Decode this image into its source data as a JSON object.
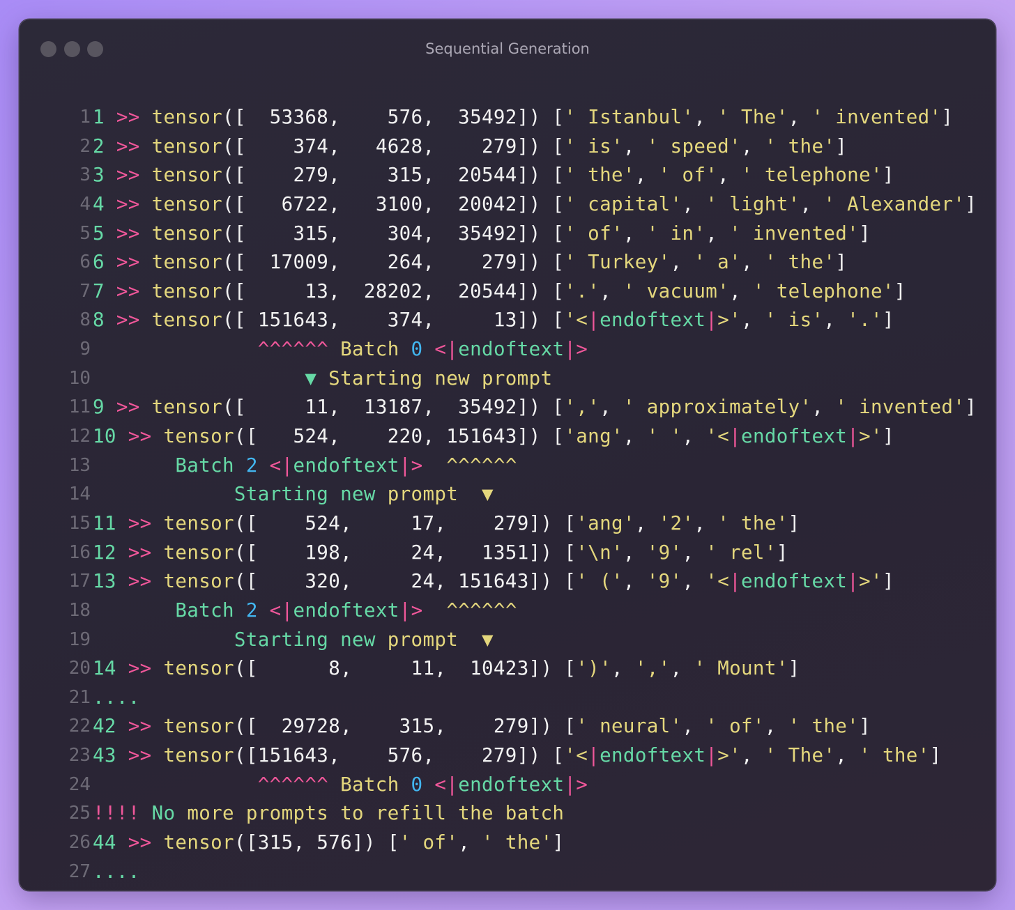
{
  "window": {
    "title": "Sequential Generation",
    "buttons": [
      "close",
      "minimize",
      "zoom"
    ]
  },
  "colors": {
    "green": "#66d9a6",
    "pink": "#f0579a",
    "yellow": "#e4d77d",
    "white": "#f2f2f2",
    "cyan": "#42b6f0",
    "line_number": "#6d6a76",
    "background": "#2a2535"
  },
  "lines": [
    {
      "n": "1",
      "segs": [
        [
          "g",
          "1"
        ],
        [
          "w",
          " "
        ],
        [
          "p",
          ">>"
        ],
        [
          "w",
          " "
        ],
        [
          "y",
          "tensor"
        ],
        [
          "w",
          "([  53368,    576,  35492]) ["
        ],
        [
          "y",
          "' Istanbul'"
        ],
        [
          "w",
          ", "
        ],
        [
          "y",
          "' The'"
        ],
        [
          "w",
          ", "
        ],
        [
          "y",
          "' invented'"
        ],
        [
          "w",
          "]"
        ]
      ]
    },
    {
      "n": "2",
      "segs": [
        [
          "g",
          "2"
        ],
        [
          "w",
          " "
        ],
        [
          "p",
          ">>"
        ],
        [
          "w",
          " "
        ],
        [
          "y",
          "tensor"
        ],
        [
          "w",
          "([    374,   4628,    279]) ["
        ],
        [
          "y",
          "' is'"
        ],
        [
          "w",
          ", "
        ],
        [
          "y",
          "' speed'"
        ],
        [
          "w",
          ", "
        ],
        [
          "y",
          "' the'"
        ],
        [
          "w",
          "]"
        ]
      ]
    },
    {
      "n": "3",
      "segs": [
        [
          "g",
          "3"
        ],
        [
          "w",
          " "
        ],
        [
          "p",
          ">>"
        ],
        [
          "w",
          " "
        ],
        [
          "y",
          "tensor"
        ],
        [
          "w",
          "([    279,    315,  20544]) ["
        ],
        [
          "y",
          "' the'"
        ],
        [
          "w",
          ", "
        ],
        [
          "y",
          "' of'"
        ],
        [
          "w",
          ", "
        ],
        [
          "y",
          "' telephone'"
        ],
        [
          "w",
          "]"
        ]
      ]
    },
    {
      "n": "4",
      "segs": [
        [
          "g",
          "4"
        ],
        [
          "w",
          " "
        ],
        [
          "p",
          ">>"
        ],
        [
          "w",
          " "
        ],
        [
          "y",
          "tensor"
        ],
        [
          "w",
          "([   6722,   3100,  20042]) ["
        ],
        [
          "y",
          "' capital'"
        ],
        [
          "w",
          ", "
        ],
        [
          "y",
          "' light'"
        ],
        [
          "w",
          ", "
        ],
        [
          "y",
          "' Alexander'"
        ],
        [
          "w",
          "]"
        ]
      ]
    },
    {
      "n": "5",
      "segs": [
        [
          "g",
          "5"
        ],
        [
          "w",
          " "
        ],
        [
          "p",
          ">>"
        ],
        [
          "w",
          " "
        ],
        [
          "y",
          "tensor"
        ],
        [
          "w",
          "([    315,    304,  35492]) ["
        ],
        [
          "y",
          "' of'"
        ],
        [
          "w",
          ", "
        ],
        [
          "y",
          "' in'"
        ],
        [
          "w",
          ", "
        ],
        [
          "y",
          "' invented'"
        ],
        [
          "w",
          "]"
        ]
      ]
    },
    {
      "n": "6",
      "segs": [
        [
          "g",
          "6"
        ],
        [
          "w",
          " "
        ],
        [
          "p",
          ">>"
        ],
        [
          "w",
          " "
        ],
        [
          "y",
          "tensor"
        ],
        [
          "w",
          "([  17009,    264,    279]) ["
        ],
        [
          "y",
          "' Turkey'"
        ],
        [
          "w",
          ", "
        ],
        [
          "y",
          "' a'"
        ],
        [
          "w",
          ", "
        ],
        [
          "y",
          "' the'"
        ],
        [
          "w",
          "]"
        ]
      ]
    },
    {
      "n": "7",
      "segs": [
        [
          "g",
          "7"
        ],
        [
          "w",
          " "
        ],
        [
          "p",
          ">>"
        ],
        [
          "w",
          " "
        ],
        [
          "y",
          "tensor"
        ],
        [
          "w",
          "([     13,  28202,  20544]) ["
        ],
        [
          "y",
          "'.'"
        ],
        [
          "w",
          ", "
        ],
        [
          "y",
          "' vacuum'"
        ],
        [
          "w",
          ", "
        ],
        [
          "y",
          "' telephone'"
        ],
        [
          "w",
          "]"
        ]
      ]
    },
    {
      "n": "8",
      "segs": [
        [
          "g",
          "8"
        ],
        [
          "w",
          " "
        ],
        [
          "p",
          ">>"
        ],
        [
          "w",
          " "
        ],
        [
          "y",
          "tensor"
        ],
        [
          "w",
          "([ 151643,    374,     13]) ["
        ],
        [
          "y",
          "'<"
        ],
        [
          "p",
          "|"
        ],
        [
          "g",
          "endoftext"
        ],
        [
          "p",
          "|"
        ],
        [
          "y",
          ">'"
        ],
        [
          "w",
          ", "
        ],
        [
          "y",
          "' is'"
        ],
        [
          "w",
          ", "
        ],
        [
          "y",
          "'.'"
        ],
        [
          "w",
          "]"
        ]
      ]
    },
    {
      "n": "9",
      "segs": [
        [
          "w",
          "              "
        ],
        [
          "p",
          "^^^^^^"
        ],
        [
          "w",
          " "
        ],
        [
          "y",
          "Batch"
        ],
        [
          "w",
          " "
        ],
        [
          "c",
          "0"
        ],
        [
          "w",
          " "
        ],
        [
          "p",
          "<|"
        ],
        [
          "g",
          "endoftext"
        ],
        [
          "p",
          "|>"
        ]
      ]
    },
    {
      "n": "10",
      "segs": [
        [
          "w",
          "                  "
        ],
        [
          "g",
          "▼"
        ],
        [
          "w",
          " "
        ],
        [
          "y",
          "Starting new prompt"
        ]
      ]
    },
    {
      "n": "11",
      "segs": [
        [
          "g",
          "9"
        ],
        [
          "w",
          " "
        ],
        [
          "p",
          ">>"
        ],
        [
          "w",
          " "
        ],
        [
          "y",
          "tensor"
        ],
        [
          "w",
          "([     11,  13187,  35492]) ["
        ],
        [
          "y",
          "','"
        ],
        [
          "w",
          ", "
        ],
        [
          "y",
          "' approximately'"
        ],
        [
          "w",
          ", "
        ],
        [
          "y",
          "' invented'"
        ],
        [
          "w",
          "]"
        ]
      ]
    },
    {
      "n": "12",
      "segs": [
        [
          "g",
          "10"
        ],
        [
          "w",
          " "
        ],
        [
          "p",
          ">>"
        ],
        [
          "w",
          " "
        ],
        [
          "y",
          "tensor"
        ],
        [
          "w",
          "([   524,    220, 151643]) ["
        ],
        [
          "y",
          "'ang'"
        ],
        [
          "w",
          ", "
        ],
        [
          "y",
          "' '"
        ],
        [
          "w",
          ", "
        ],
        [
          "y",
          "'<"
        ],
        [
          "p",
          "|"
        ],
        [
          "g",
          "endoftext"
        ],
        [
          "p",
          "|"
        ],
        [
          "y",
          ">'"
        ],
        [
          "w",
          "]"
        ]
      ]
    },
    {
      "n": "13",
      "segs": [
        [
          "w",
          "       "
        ],
        [
          "g",
          "Batch"
        ],
        [
          "w",
          " "
        ],
        [
          "c",
          "2"
        ],
        [
          "w",
          " "
        ],
        [
          "p",
          "<|"
        ],
        [
          "g",
          "endoftext"
        ],
        [
          "p",
          "|>"
        ],
        [
          "w",
          "  "
        ],
        [
          "y",
          "^^^^^^"
        ]
      ]
    },
    {
      "n": "14",
      "segs": [
        [
          "w",
          "            "
        ],
        [
          "g",
          "Starting"
        ],
        [
          "w",
          " "
        ],
        [
          "g",
          "new"
        ],
        [
          "w",
          " "
        ],
        [
          "y",
          "prompt"
        ],
        [
          "w",
          "  "
        ],
        [
          "y",
          "▼"
        ]
      ]
    },
    {
      "n": "15",
      "segs": [
        [
          "g",
          "11"
        ],
        [
          "w",
          " "
        ],
        [
          "p",
          ">>"
        ],
        [
          "w",
          " "
        ],
        [
          "y",
          "tensor"
        ],
        [
          "w",
          "([    524,     17,    279]) ["
        ],
        [
          "y",
          "'ang'"
        ],
        [
          "w",
          ", "
        ],
        [
          "y",
          "'2'"
        ],
        [
          "w",
          ", "
        ],
        [
          "y",
          "' the'"
        ],
        [
          "w",
          "]"
        ]
      ]
    },
    {
      "n": "16",
      "segs": [
        [
          "g",
          "12"
        ],
        [
          "w",
          " "
        ],
        [
          "p",
          ">>"
        ],
        [
          "w",
          " "
        ],
        [
          "y",
          "tensor"
        ],
        [
          "w",
          "([    198,     24,   1351]) ["
        ],
        [
          "y",
          "'\\n'"
        ],
        [
          "w",
          ", "
        ],
        [
          "y",
          "'9'"
        ],
        [
          "w",
          ", "
        ],
        [
          "y",
          "' rel'"
        ],
        [
          "w",
          "]"
        ]
      ]
    },
    {
      "n": "17",
      "segs": [
        [
          "g",
          "13"
        ],
        [
          "w",
          " "
        ],
        [
          "p",
          ">>"
        ],
        [
          "w",
          " "
        ],
        [
          "y",
          "tensor"
        ],
        [
          "w",
          "([    320,     24, 151643]) ["
        ],
        [
          "y",
          "' ('"
        ],
        [
          "w",
          ", "
        ],
        [
          "y",
          "'9'"
        ],
        [
          "w",
          ", "
        ],
        [
          "y",
          "'<"
        ],
        [
          "p",
          "|"
        ],
        [
          "g",
          "endoftext"
        ],
        [
          "p",
          "|"
        ],
        [
          "y",
          ">'"
        ],
        [
          "w",
          "]"
        ]
      ]
    },
    {
      "n": "18",
      "segs": [
        [
          "w",
          "       "
        ],
        [
          "g",
          "Batch"
        ],
        [
          "w",
          " "
        ],
        [
          "c",
          "2"
        ],
        [
          "w",
          " "
        ],
        [
          "p",
          "<|"
        ],
        [
          "g",
          "endoftext"
        ],
        [
          "p",
          "|>"
        ],
        [
          "w",
          "  "
        ],
        [
          "y",
          "^^^^^^"
        ]
      ]
    },
    {
      "n": "19",
      "segs": [
        [
          "w",
          "            "
        ],
        [
          "g",
          "Starting"
        ],
        [
          "w",
          " "
        ],
        [
          "g",
          "new"
        ],
        [
          "w",
          " "
        ],
        [
          "y",
          "prompt"
        ],
        [
          "w",
          "  "
        ],
        [
          "y",
          "▼"
        ]
      ]
    },
    {
      "n": "20",
      "segs": [
        [
          "g",
          "14"
        ],
        [
          "w",
          " "
        ],
        [
          "p",
          ">>"
        ],
        [
          "w",
          " "
        ],
        [
          "y",
          "tensor"
        ],
        [
          "w",
          "([      8,     11,  10423]) ["
        ],
        [
          "y",
          "')'"
        ],
        [
          "w",
          ", "
        ],
        [
          "y",
          "','"
        ],
        [
          "w",
          ", "
        ],
        [
          "y",
          "' Mount'"
        ],
        [
          "w",
          "]"
        ]
      ]
    },
    {
      "n": "21",
      "segs": [
        [
          "g",
          "...."
        ]
      ]
    },
    {
      "n": "22",
      "segs": [
        [
          "g",
          "42"
        ],
        [
          "w",
          " "
        ],
        [
          "p",
          ">>"
        ],
        [
          "w",
          " "
        ],
        [
          "y",
          "tensor"
        ],
        [
          "w",
          "([  29728,    315,    279]) ["
        ],
        [
          "y",
          "' neural'"
        ],
        [
          "w",
          ", "
        ],
        [
          "y",
          "' of'"
        ],
        [
          "w",
          ", "
        ],
        [
          "y",
          "' the'"
        ],
        [
          "w",
          "]"
        ]
      ]
    },
    {
      "n": "23",
      "segs": [
        [
          "g",
          "43"
        ],
        [
          "w",
          " "
        ],
        [
          "p",
          ">>"
        ],
        [
          "w",
          " "
        ],
        [
          "y",
          "tensor"
        ],
        [
          "w",
          "([151643,    576,    279]) ["
        ],
        [
          "y",
          "'<"
        ],
        [
          "p",
          "|"
        ],
        [
          "g",
          "endoftext"
        ],
        [
          "p",
          "|"
        ],
        [
          "y",
          ">'"
        ],
        [
          "w",
          ", "
        ],
        [
          "y",
          "' The'"
        ],
        [
          "w",
          ", "
        ],
        [
          "y",
          "' the'"
        ],
        [
          "w",
          "]"
        ]
      ]
    },
    {
      "n": "24",
      "segs": [
        [
          "w",
          "              "
        ],
        [
          "p",
          "^^^^^^"
        ],
        [
          "w",
          " "
        ],
        [
          "y",
          "Batch"
        ],
        [
          "w",
          " "
        ],
        [
          "c",
          "0"
        ],
        [
          "w",
          " "
        ],
        [
          "p",
          "<|"
        ],
        [
          "g",
          "endoftext"
        ],
        [
          "p",
          "|>"
        ]
      ]
    },
    {
      "n": "25",
      "segs": [
        [
          "p",
          "!!!!"
        ],
        [
          "w",
          " "
        ],
        [
          "g",
          "No"
        ],
        [
          "w",
          " "
        ],
        [
          "y",
          "more prompts to refill the batch"
        ]
      ]
    },
    {
      "n": "26",
      "segs": [
        [
          "g",
          "44"
        ],
        [
          "w",
          " "
        ],
        [
          "p",
          ">>"
        ],
        [
          "w",
          " "
        ],
        [
          "y",
          "tensor"
        ],
        [
          "w",
          "([315, 576]) ["
        ],
        [
          "y",
          "' of'"
        ],
        [
          "w",
          ", "
        ],
        [
          "y",
          "' the'"
        ],
        [
          "w",
          "]"
        ]
      ]
    },
    {
      "n": "27",
      "segs": [
        [
          "g",
          "...."
        ]
      ]
    }
  ]
}
